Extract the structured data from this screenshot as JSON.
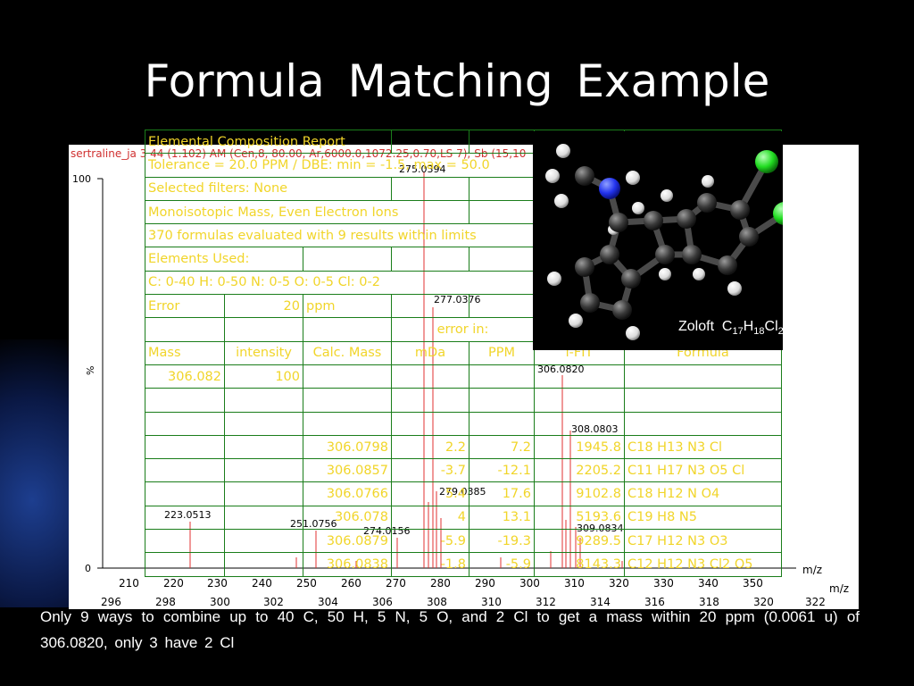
{
  "slide": {
    "title": "Formula  Matching  Example",
    "caption": "Only  9  ways  to  combine  up  to  40 C,  50 H,  5 N,  5 O,  and 2 Cl  to  get  a  mass  within  20  ppm  (0.0061 u)  of  306.0820,  only  3 have  2  Cl",
    "background_color": "#000000"
  },
  "spectrum": {
    "header": "sertraline_ja  3 44 (1.102) AM (Cen,8, 80.00, Ar,6000.0,1072.25,0.70,LS 7); Sb (15,10",
    "y_axis_label": "%",
    "y_ticks": [
      "100",
      "0"
    ],
    "x_ticks_top": [
      "210",
      "220",
      "230",
      "240",
      "250",
      "260",
      "270",
      "280",
      "290",
      "300",
      "310",
      "320",
      "330",
      "340",
      "350"
    ],
    "x_ticks_bottom": [
      "296",
      "298",
      "300",
      "302",
      "304",
      "306",
      "308",
      "310",
      "312",
      "314",
      "316",
      "318",
      "320",
      "322"
    ],
    "x_unit": "m/z",
    "peak_color": "#e03030",
    "peak_labels": [
      "275.0394",
      "277.0376",
      "306.0820",
      "308.0803",
      "223.0513",
      "251.0756",
      "274.0156",
      "279.0385",
      "309.0834"
    ]
  },
  "composition_table": {
    "text_color": "#f1d52a",
    "border_color": "#1a7d1a",
    "title": "Elemental Composition Report",
    "tolerance": "Tolerance = 20.0 PPM   /   DBE: min = -1.5, max = 50.0",
    "filters": "Selected filters: None",
    "mass_type": "Monoisotopic Mass, Even Electron Ions",
    "summary": "370 formulas evaluated with 9 results within limits",
    "elements_heading": "Elements Used:",
    "elements": "C: 0-40    H: 0-50    N: 0-5    O: 0-5    Cl: 0-2",
    "error_label": "Error",
    "error_value": "20",
    "error_unit": "ppm",
    "error_in": "error in:",
    "headers": [
      "Mass",
      "intensity",
      "Calc. Mass",
      "mDa",
      "PPM",
      "i-FIT",
      "Formula"
    ],
    "query_mass": "306.082",
    "query_intensity": "100",
    "rows": [
      {
        "calc": "306.0798",
        "mda": "2.2",
        "ppm": "7.2",
        "ifit": "1945.8",
        "formula": "C18  H13  N3  Cl"
      },
      {
        "calc": "306.0857",
        "mda": "-3.7",
        "ppm": "-12.1",
        "ifit": "2205.2",
        "formula": "C11  H17  N3  O5  Cl"
      },
      {
        "calc": "306.0766",
        "mda": "5.4",
        "ppm": "17.6",
        "ifit": "9102.8",
        "formula": "C18  H12  N  O4"
      },
      {
        "calc": "306.078",
        "mda": "4",
        "ppm": "13.1",
        "ifit": "5193.6",
        "formula": "C19  H8  N5"
      },
      {
        "calc": "306.0879",
        "mda": "-5.9",
        "ppm": "-19.3",
        "ifit": "9289.5",
        "formula": "C17  H12  N3  O3"
      },
      {
        "calc": "306.0838",
        "mda": "-1.8",
        "ppm": "-5.9",
        "ifit": "8143.3",
        "formula": "C12  H12  N3  Cl2  O5"
      }
    ]
  },
  "molecule": {
    "caption_name": "Zoloft",
    "formula_parts": [
      "C",
      "17",
      "H",
      "18",
      "Cl",
      "2",
      "N"
    ],
    "atom_colors": {
      "carbon": "#3a3a3a",
      "hydrogen": "#f2f2f2",
      "nitrogen": "#2233ee",
      "chlorine": "#22dd22"
    }
  }
}
